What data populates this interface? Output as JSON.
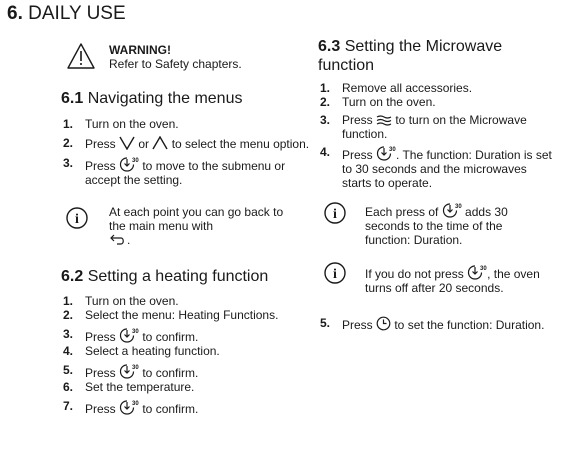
{
  "chapter": {
    "number": "6.",
    "title": "DAILY USE"
  },
  "warning": {
    "icon": "warning-triangle-icon",
    "title": "WARNING!",
    "text": "Refer to Safety chapters."
  },
  "s61": {
    "number": "6.1",
    "title": "Navigating the menus",
    "steps": [
      {
        "n": "1.",
        "a": "Turn on the oven."
      },
      {
        "n": "2.",
        "a": "Press ",
        "b": " or ",
        "c": " to select the menu option."
      },
      {
        "n": "3.",
        "a": "Press ",
        "b": " to move to the submenu or accept the setting."
      }
    ],
    "note": {
      "icon": "info-icon",
      "text": "At each point you can go back to the main menu with",
      "end": "."
    }
  },
  "s62": {
    "number": "6.2",
    "title": "Setting a heating function",
    "steps": [
      {
        "n": "1.",
        "a": "Turn on the oven."
      },
      {
        "n": "2.",
        "a": "Select the menu: Heating Functions."
      },
      {
        "n": "3.",
        "a": "Press ",
        "b": " to confirm."
      },
      {
        "n": "4.",
        "a": "Select a heating function."
      },
      {
        "n": "5.",
        "a": "Press ",
        "b": " to confirm."
      },
      {
        "n": "6.",
        "a": "Set the temperature."
      },
      {
        "n": "7.",
        "a": "Press ",
        "b": " to confirm."
      }
    ]
  },
  "s63": {
    "number": "6.3",
    "title1": "Setting the Microwave",
    "title2": "function",
    "steps": [
      {
        "n": "1.",
        "a": "Remove all accessories."
      },
      {
        "n": "2.",
        "a": "Turn on the oven."
      },
      {
        "n": "3.",
        "a": "Press ",
        "b": " to turn on the Microwave function."
      },
      {
        "n": "4.",
        "a": "Press ",
        "b": ". The function: Duration is set to 30 seconds and the microwaves starts to operate."
      },
      {
        "n": "5.",
        "a": "Press ",
        "b": " to set the function: Duration."
      }
    ],
    "note1": {
      "icon": "info-icon",
      "a": "Each press of ",
      "b": " adds 30 seconds to the time of the function: Duration."
    },
    "note2": {
      "icon": "info-icon",
      "a": "If you do not press ",
      "b": ", the oven turns off after 20 seconds."
    }
  },
  "icons": {
    "down": "chevron-down-icon",
    "up": "chevron-up-icon",
    "ok30": "confirm-30-icon",
    "back": "back-arrow-icon",
    "mw": "microwave-icon",
    "clock": "clock-icon"
  }
}
